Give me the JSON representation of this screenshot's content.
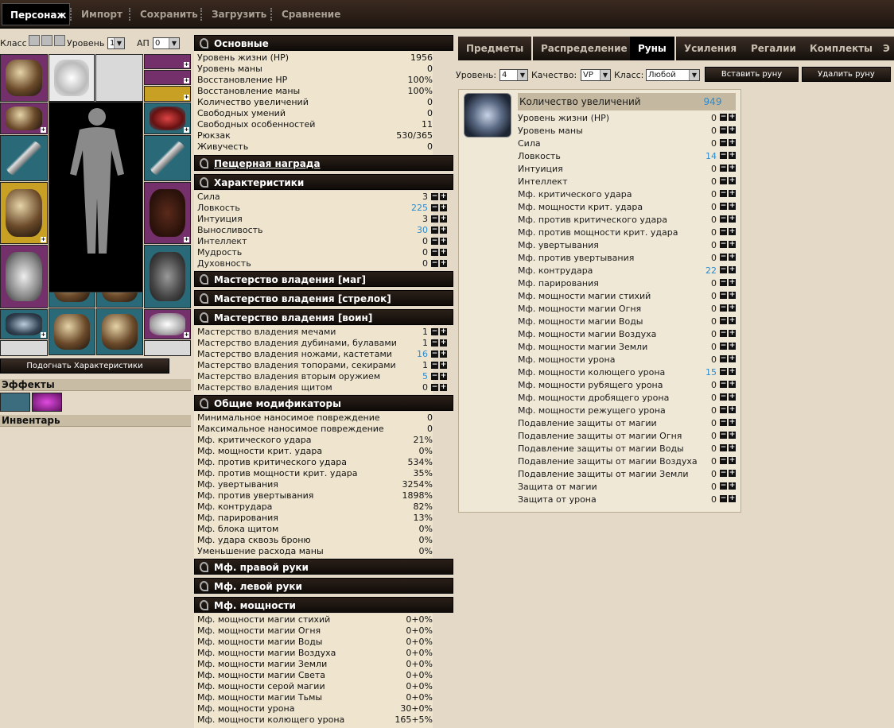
{
  "top_tabs": [
    "Персонаж",
    "Импорт",
    "Сохранить",
    "Загрузить",
    "Сравнение"
  ],
  "left": {
    "class_label": "Класс",
    "level_label": "Уровень",
    "level_value": "10",
    "ap_label": "АП",
    "ap_value": "0",
    "adjust_button": "Подогнать Характеристики",
    "effects_label": "Эффекты",
    "inventory_label": "Инвентарь"
  },
  "sections": {
    "basic": {
      "title": "Основные",
      "rows": [
        [
          "Уровень жизни (HP)",
          "1956"
        ],
        [
          "Уровень маны",
          "0"
        ],
        [
          "Восстановление HP",
          "100%"
        ],
        [
          "Восстановление маны",
          "100%"
        ],
        [
          "Количество увеличений",
          "0"
        ],
        [
          "Свободных умений",
          "0"
        ],
        [
          "Свободных особенностей",
          "11"
        ],
        [
          "Рюкзак",
          "530/365"
        ],
        [
          "Живучесть",
          "0"
        ]
      ]
    },
    "cave": {
      "title": "Пещерная награда"
    },
    "chars": {
      "title": "Характеристики",
      "rows": [
        [
          "Сила",
          "3",
          false
        ],
        [
          "Ловкость",
          "225",
          true
        ],
        [
          "Интуиция",
          "3",
          false
        ],
        [
          "Выносливость",
          "30",
          true
        ],
        [
          "Интеллект",
          "0",
          false
        ],
        [
          "Мудрость",
          "0",
          false
        ],
        [
          "Духовность",
          "0",
          false
        ]
      ]
    },
    "mage": {
      "title": "Мастерство владения [маг]"
    },
    "archer": {
      "title": "Мастерство владения [стрелок]"
    },
    "warrior": {
      "title": "Мастерство владения [воин]",
      "rows": [
        [
          "Мастерство владения мечами",
          "1",
          false
        ],
        [
          "Мастерство владения дубинами, булавами",
          "1",
          false
        ],
        [
          "Мастерство владения ножами, кастетами",
          "16",
          true
        ],
        [
          "Мастерство владения топорами, секирами",
          "1",
          false
        ],
        [
          "Мастерство владения вторым оружием",
          "5",
          true
        ],
        [
          "Мастерство владения щитом",
          "0",
          false
        ]
      ]
    },
    "mods": {
      "title": "Общие модификаторы",
      "rows": [
        [
          "Минимальное наносимое повреждение",
          "0"
        ],
        [
          "Максимальное наносимое повреждение",
          "0"
        ],
        [
          "Мф. критического удара",
          "21%"
        ],
        [
          "Мф. мощности крит. удара",
          "0%"
        ],
        [
          "Мф. против критического удара",
          "534%"
        ],
        [
          "Мф. против мощности крит. удара",
          "35%"
        ],
        [
          "Мф. увертывания",
          "3254%"
        ],
        [
          "Мф. против увертывания",
          "1898%"
        ],
        [
          "Мф. контрудара",
          "82%"
        ],
        [
          "Мф. парирования",
          "13%"
        ],
        [
          "Мф. блока щитом",
          "0%"
        ],
        [
          "Мф. удара сквозь броню",
          "0%"
        ],
        [
          "Уменьшение расхода маны",
          "0%"
        ]
      ]
    },
    "right_hand": {
      "title": "Мф. правой руки"
    },
    "left_hand": {
      "title": "Мф. левой руки"
    },
    "power": {
      "title": "Мф. мощности",
      "rows": [
        [
          "Мф. мощности магии стихий",
          "0+0%"
        ],
        [
          "Мф. мощности магии Огня",
          "0+0%"
        ],
        [
          "Мф. мощности магии Воды",
          "0+0%"
        ],
        [
          "Мф. мощности магии Воздуха",
          "0+0%"
        ],
        [
          "Мф. мощности магии Земли",
          "0+0%"
        ],
        [
          "Мф. мощности магии Света",
          "0+0%"
        ],
        [
          "Мф. мощности серой магии",
          "0+0%"
        ],
        [
          "Мф. мощности магии Тьмы",
          "0+0%"
        ],
        [
          "Мф. мощности урона",
          "30+0%"
        ],
        [
          "Мф. мощности колющего урона",
          "165+5%"
        ]
      ]
    }
  },
  "right": {
    "tabs": [
      "Предметы",
      "Распределение",
      "Руны",
      "Усиления",
      "Регалии",
      "Комплекты",
      "Э"
    ],
    "level_label": "Уровень:",
    "level_value": "4",
    "quality_label": "Качество:",
    "quality_value": "VP",
    "class_label": "Класс:",
    "class_value": "Любой",
    "insert_button": "Вставить руну",
    "remove_button": "Удалить руну",
    "rune_head": "Количество увеличений",
    "rune_head_value": "949",
    "rune_rows": [
      [
        "Уровень жизни (HP)",
        "0",
        false
      ],
      [
        "Уровень маны",
        "0",
        false
      ],
      [
        "Сила",
        "0",
        false
      ],
      [
        "Ловкость",
        "14",
        true
      ],
      [
        "Интуиция",
        "0",
        false
      ],
      [
        "Интеллект",
        "0",
        false
      ],
      [
        "Мф. критического удара",
        "0",
        false
      ],
      [
        "Мф. мощности крит. удара",
        "0",
        false
      ],
      [
        "Мф. против критического удара",
        "0",
        false
      ],
      [
        "Мф. против мощности крит. удара",
        "0",
        false
      ],
      [
        "Мф. увертывания",
        "0",
        false
      ],
      [
        "Мф. против увертывания",
        "0",
        false
      ],
      [
        "Мф. контрудара",
        "22",
        true
      ],
      [
        "Мф. парирования",
        "0",
        false
      ],
      [
        "Мф. мощности магии стихий",
        "0",
        false
      ],
      [
        "Мф. мощности магии Огня",
        "0",
        false
      ],
      [
        "Мф. мощности магии Воды",
        "0",
        false
      ],
      [
        "Мф. мощности магии Воздуха",
        "0",
        false
      ],
      [
        "Мф. мощности магии Земли",
        "0",
        false
      ],
      [
        "Мф. мощности урона",
        "0",
        false
      ],
      [
        "Мф. мощности колющего урона",
        "15",
        true
      ],
      [
        "Мф. мощности рубящего урона",
        "0",
        false
      ],
      [
        "Мф. мощности дробящего урона",
        "0",
        false
      ],
      [
        "Мф. мощности режущего урона",
        "0",
        false
      ],
      [
        "Подавление защиты от магии",
        "0",
        false
      ],
      [
        "Подавление защиты от магии Огня",
        "0",
        false
      ],
      [
        "Подавление защиты от магии Воды",
        "0",
        false
      ],
      [
        "Подавление защиты от магии Воздуха",
        "0",
        false
      ],
      [
        "Подавление защиты от магии Земли",
        "0",
        false
      ],
      [
        "Защита от магии",
        "0",
        false
      ],
      [
        "Защита от урона",
        "0",
        false
      ]
    ]
  }
}
